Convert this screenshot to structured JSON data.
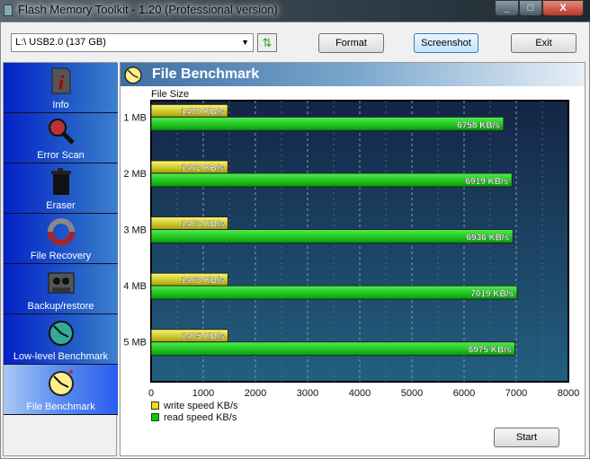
{
  "window": {
    "title": "Flash Memory Toolkit - 1.20 (Professional version)",
    "controls": [
      "minimize",
      "maximize",
      "close"
    ]
  },
  "toolbar": {
    "drive_value": "L:\\ USB2.0 (137 GB)",
    "refresh_icon": "refresh-icon",
    "format_label": "Format",
    "screenshot_label": "Screenshot",
    "exit_label": "Exit"
  },
  "sidebar": {
    "items": [
      {
        "label": "Info",
        "icon": "info-icon"
      },
      {
        "label": "Error Scan",
        "icon": "magnifier-icon"
      },
      {
        "label": "Eraser",
        "icon": "trash-icon"
      },
      {
        "label": "File Recovery",
        "icon": "lifebuoy-icon"
      },
      {
        "label": "Backup/restore",
        "icon": "tape-icon"
      },
      {
        "label": "Low-level Benchmark",
        "icon": "stopwatch-icon"
      },
      {
        "label": "File Benchmark",
        "icon": "stopwatch-icon",
        "selected": true
      }
    ]
  },
  "panel": {
    "title": "File Benchmark",
    "start_label": "Start"
  },
  "chart_data": {
    "type": "bar",
    "orientation": "horizontal",
    "ylabel": "File Size",
    "categories": [
      "1 MB",
      "2 MB",
      "3 MB",
      "4 MB",
      "5 MB"
    ],
    "series": [
      {
        "name": "write speed KB/s",
        "values": [
          1470,
          1472,
          1473,
          1473,
          1475
        ],
        "labels": [
          "1470 KB/s",
          "1472 KB/s",
          "1473 KB/s",
          "1473 KB/s",
          "1475 KB/s"
        ],
        "color": "#e8e000"
      },
      {
        "name": "read speed KB/s",
        "values": [
          6758,
          6919,
          6936,
          7019,
          6975
        ],
        "labels": [
          "6758 KB/s",
          "6919 KB/s",
          "6936 KB/s",
          "7019 KB/s",
          "6975 KB/s"
        ],
        "color": "#00d000"
      }
    ],
    "xlim": [
      0,
      8000
    ],
    "xticks": [
      "0",
      "1000",
      "2000",
      "3000",
      "4000",
      "5000",
      "6000",
      "7000",
      "8000"
    ],
    "grid": true,
    "legend": "bottom-left"
  }
}
